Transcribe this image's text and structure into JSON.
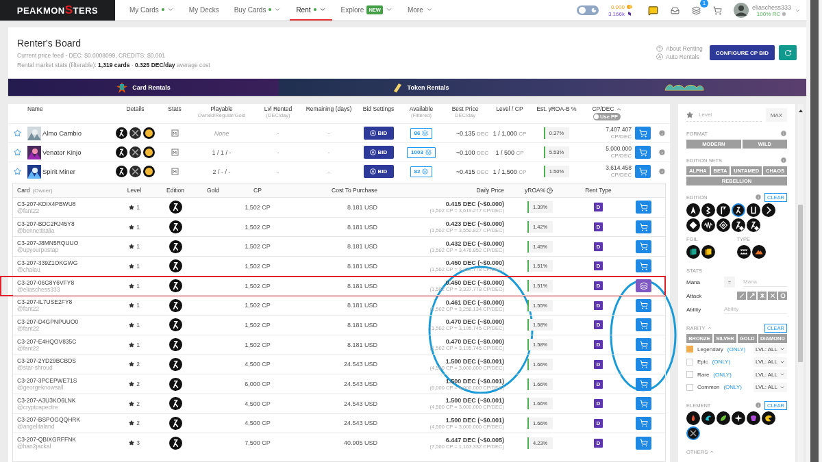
{
  "nav": {
    "logo": {
      "before": "PEAKMON",
      "accent": "S",
      "after": "TERS"
    },
    "items": [
      {
        "label": "My Cards",
        "dot": true,
        "caret": true,
        "selected": false
      },
      {
        "label": "My Decks",
        "dot": false,
        "caret": false,
        "selected": false
      },
      {
        "label": "Buy Cards",
        "dot": true,
        "caret": true,
        "selected": false
      },
      {
        "label": "Rent",
        "dot": true,
        "caret": true,
        "selected": true
      },
      {
        "label": "Explore",
        "dot": false,
        "badge": "NEW",
        "caret": true,
        "selected": false
      },
      {
        "label": "More",
        "dot": false,
        "caret": true,
        "selected": false
      }
    ],
    "dark_mode": {
      "on": false
    },
    "balances": [
      {
        "value": "0.000",
        "kind": "dec"
      },
      {
        "value": "3.166k",
        "kind": "sps"
      }
    ],
    "notifications": "1",
    "user": {
      "name": "eliaschess333",
      "rc": "100% RC"
    }
  },
  "header": {
    "title": "Renter's Board",
    "price_feed": "Current price feed - DEC: $0.0008099, CREDITS: $0.001",
    "stats": "Rental market stats (filterable): **1,319 cards**  ·  **0.325 DEC/day** average cost",
    "links": [
      {
        "label": "About Renting",
        "kind": "help"
      },
      {
        "label": "Auto Rentals",
        "kind": "auto"
      }
    ],
    "configure": "CONFIGURE CP BID"
  },
  "banner": [
    {
      "kind": "cards",
      "label": "Card Rentals"
    },
    {
      "kind": "tokens",
      "label": "Token Rentals"
    },
    {
      "kind": "logo"
    }
  ],
  "rentals": {
    "columns": [
      {
        "label": "Name"
      },
      {
        "label": "Details"
      },
      {
        "label": "Stats"
      },
      {
        "label": "Playable",
        "sub": "Owned/Regular/Gold"
      },
      {
        "label": "Lvl Rented",
        "sub": "(DEC/day)"
      },
      {
        "label": "Remaining (days)"
      },
      {
        "label": "Bid Settings"
      },
      {
        "label": "Available",
        "sub": "(Filtered)"
      },
      {
        "label": "Best Price",
        "sub": "DEC/day"
      },
      {
        "label": "Level / CP"
      },
      {
        "label": "Est. yROA-B %"
      },
      {
        "label": "CP/DEC",
        "sort_ascending": true
      }
    ],
    "use_pp": {
      "label": "Use PP",
      "on": false
    },
    "rows": [
      {
        "name": "Almo Cambio",
        "favorite": false,
        "playable": {
          "text": "None",
          "kind": "empty"
        },
        "lvl_rented": "-",
        "remaining": "-",
        "bid": "BID",
        "available": "86",
        "best_price": "~0.135",
        "best_unit": "DEC",
        "level": "1 / 1,000",
        "level_unit": "CP",
        "yroa": "0.37%",
        "cp_dec": "7,407.407",
        "cp_dec_unit": "CP/DEC"
      },
      {
        "name": "Venator Kinjo",
        "favorite": false,
        "playable": {
          "text": "1 / 1 / -",
          "kind": "count"
        },
        "lvl_rented": "-",
        "remaining": "-",
        "bid": "BID",
        "available": "1003",
        "best_price": "~0.100",
        "best_unit": "DEC",
        "level": "1 / 500",
        "level_unit": "CP",
        "yroa": "5.53%",
        "cp_dec": "5,000.000",
        "cp_dec_unit": "CP/DEC"
      },
      {
        "name": "Spirit Miner",
        "favorite": false,
        "playable": {
          "text": "2 / - / -",
          "kind": "count"
        },
        "lvl_rented": "-",
        "remaining": "-",
        "bid": "BID",
        "available": "82",
        "best_price": "~0.415",
        "best_unit": "DEC",
        "level": "1 / 1,500",
        "level_unit": "CP",
        "yroa": "1.50%",
        "cp_dec": "3,614.458",
        "cp_dec_unit": "CP/DEC"
      }
    ]
  },
  "listings": {
    "columns": [
      {
        "label": "Card",
        "sub": "(Owner)",
        "help": false
      },
      {
        "label": "Level",
        "help": false
      },
      {
        "label": "Edition",
        "help": false
      },
      {
        "label": "Gold",
        "help": false
      },
      {
        "label": "CP",
        "help": false
      },
      {
        "label": "Cost To Purchase",
        "help": false
      },
      {
        "label": "Daily Price",
        "help": false
      },
      {
        "label": "yROA%",
        "help": true
      },
      {
        "label": "Rent Type",
        "help": false
      }
    ],
    "rows": [
      {
        "id": "C3-207-KDIX4PBWU8",
        "owner": "@fant22",
        "level": "1",
        "cp": "1,502 CP",
        "cost": "8.181 USD",
        "price": "0.415 DEC (~$0.000)",
        "price_detail": "(1,502 CP = 3,619.277 CP/DEC)",
        "yroa": "1.39%",
        "rent_type": "D",
        "own": false,
        "highlighted": false
      },
      {
        "id": "C3-207-BDC2RJ45Y8",
        "owner": "@bennettitalia",
        "level": "1",
        "cp": "1,502 CP",
        "cost": "8.181 USD",
        "price": "0.423 DEC (~$0.000)",
        "price_detail": "(1,502 CP = 3,550.827 CP/DEC)",
        "yroa": "1.42%",
        "rent_type": "D",
        "own": false,
        "highlighted": false
      },
      {
        "id": "C3-207-J8MN5RQUUO",
        "owner": "@upyourpostap",
        "level": "1",
        "cp": "1,502 CP",
        "cost": "8.181 USD",
        "price": "0.432 DEC (~$0.000)",
        "price_detail": "(1,502 CP = 3,476.852 CP/DEC)",
        "yroa": "1.45%",
        "rent_type": "D",
        "own": false,
        "highlighted": false
      },
      {
        "id": "C3-207-339Z1OKGWG",
        "owner": "@chalau",
        "level": "1",
        "cp": "1,502 CP",
        "cost": "8.181 USD",
        "price": "0.450 DEC (~$0.000)",
        "price_detail": "(1,502 CP = 3,337.778 CP/DEC)",
        "yroa": "1.51%",
        "rent_type": "D",
        "own": false,
        "highlighted": false
      },
      {
        "id": "C3-207-06G8Y6VFY8",
        "owner": "@eliaschess333",
        "level": "1",
        "cp": "1,502 CP",
        "cost": "8.181 USD",
        "price": "0.450 DEC (~$0.000)",
        "price_detail": "(1,502 CP = 3,337.778 CP/DEC)",
        "yroa": "1.51%",
        "rent_type": "D",
        "own": true,
        "highlighted": true
      },
      {
        "id": "C3-207-IL7USE2FY8",
        "owner": "@fant22",
        "level": "1",
        "cp": "1,502 CP",
        "cost": "8.181 USD",
        "price": "0.461 DEC (~$0.000)",
        "price_detail": "(1,502 CP = 3,258.134 CP/DEC)",
        "yroa": "1.55%",
        "rent_type": "D",
        "own": false,
        "highlighted": false
      },
      {
        "id": "C3-207-D4GPNPUUO0",
        "owner": "@fant22",
        "level": "1",
        "cp": "1,502 CP",
        "cost": "8.181 USD",
        "price": "0.470 DEC (~$0.000)",
        "price_detail": "(1,502 CP = 3,195.745 CP/DEC)",
        "yroa": "1.58%",
        "rent_type": "D",
        "own": false,
        "highlighted": false
      },
      {
        "id": "C3-207-E4HQOV835C",
        "owner": "@fant22",
        "level": "1",
        "cp": "1,502 CP",
        "cost": "8.181 USD",
        "price": "0.470 DEC (~$0.000)",
        "price_detail": "(1,502 CP = 3,195.745 CP/DEC)",
        "yroa": "1.58%",
        "rent_type": "D",
        "own": false,
        "highlighted": false
      },
      {
        "id": "C3-207-2YD29BCBDS",
        "owner": "@star-shroud",
        "level": "2",
        "cp": "4,500 CP",
        "cost": "24.543 USD",
        "price": "1.500 DEC (~$0.001)",
        "price_detail": "(4,500 CP = 3,000.000 CP/DEC)",
        "yroa": "1.66%",
        "rent_type": "D",
        "own": false,
        "highlighted": false
      },
      {
        "id": "C3-207-3PCEPWE71S",
        "owner": "@georgeknowsall",
        "level": "2",
        "cp": "6,000 CP",
        "cost": "24.543 USD",
        "price": "1.500 DEC (~$0.001)",
        "price_detail": "(6,000 CP = 4,000.000 CP/DEC)",
        "yroa": "1.66%",
        "rent_type": "D",
        "own": false,
        "highlighted": false
      },
      {
        "id": "C3-207-A3U3KO6LNK",
        "owner": "@cryptospectre",
        "level": "2",
        "cp": "4,500 CP",
        "cost": "24.543 USD",
        "price": "1.500 DEC (~$0.001)",
        "price_detail": "(4,500 CP = 3,000.000 CP/DEC)",
        "yroa": "1.66%",
        "rent_type": "D",
        "own": false,
        "highlighted": false
      },
      {
        "id": "C3-207-BSPOGQQHRK",
        "owner": "@angelitaland",
        "level": "2",
        "cp": "4,500 CP",
        "cost": "24.543 USD",
        "price": "1.500 DEC (~$0.001)",
        "price_detail": "(4,500 CP = 3,000.000 CP/DEC)",
        "yroa": "1.66%",
        "rent_type": "D",
        "own": false,
        "highlighted": false
      },
      {
        "id": "C3-207-QBIXGRFFNK",
        "owner": "@han2jackal",
        "level": "3",
        "cp": "7,500 CP",
        "cost": "40.905 USD",
        "price": "6.447 DEC (~$0.005)",
        "price_detail": "(7,500 CP = 1,163.332 CP/DEC)",
        "yroa": "4.23%",
        "rent_type": "D",
        "own": false,
        "highlighted": false
      }
    ]
  },
  "filters": {
    "level": {
      "placeholder": "Level",
      "button": "MAX"
    },
    "format": {
      "title": "FORMAT",
      "options": [
        {
          "label": "MODERN",
          "selected": false
        },
        {
          "label": "WILD",
          "selected": false
        }
      ]
    },
    "edition_sets": {
      "title": "EDITION SETS",
      "options": [
        {
          "label": "ALPHA",
          "selected": false
        },
        {
          "label": "BETA",
          "selected": false
        },
        {
          "label": "UNTAMED",
          "selected": false
        },
        {
          "label": "CHAOS",
          "selected": false
        },
        {
          "label": "REBELLION",
          "selected": false
        }
      ]
    },
    "edition": {
      "title": "EDITION",
      "clear": "CLEAR",
      "icons": [
        {
          "kind": "arrow",
          "selected": false
        },
        {
          "kind": "zigzag",
          "selected": false
        },
        {
          "kind": "flag",
          "selected": false
        },
        {
          "kind": "runner",
          "selected": true
        },
        {
          "kind": "pillar",
          "selected": false
        },
        {
          "kind": "chevron",
          "selected": false
        },
        {
          "kind": "diamond",
          "selected": false
        },
        {
          "kind": "wave",
          "selected": false
        },
        {
          "kind": "gem",
          "selected": false
        },
        {
          "kind": "runner-badge",
          "selected": false
        },
        {
          "kind": "runner-gem",
          "selected": false
        }
      ]
    },
    "foil": {
      "title": "FOIL",
      "icons": [
        {
          "kind": "teal-cards",
          "selected": false
        },
        {
          "kind": "gold-cards",
          "selected": false
        }
      ]
    },
    "type": {
      "title": "TYPE",
      "icons": [
        {
          "kind": "fangs",
          "selected": false
        },
        {
          "kind": "mountain",
          "selected": false
        }
      ]
    },
    "stats": {
      "title": "STATS",
      "mana": {
        "label": "Mana",
        "operator": "=",
        "placeholder": "Mana"
      },
      "attack": {
        "label": "Attack",
        "icons": [
          {
            "kind": "sword",
            "selected": false
          },
          {
            "kind": "arrow",
            "selected": false
          },
          {
            "kind": "burst",
            "selected": false
          },
          {
            "kind": "cross",
            "selected": false
          },
          {
            "kind": "ring",
            "selected": false
          }
        ]
      },
      "ability": {
        "label": "Ability",
        "placeholder": "Ability"
      }
    },
    "rarity": {
      "title": "RARITY",
      "expanded": true,
      "clear": "CLEAR",
      "tiers": [
        {
          "label": "BRONZE",
          "selected": false
        },
        {
          "label": "SILVER",
          "selected": false
        },
        {
          "label": "GOLD",
          "selected": false
        },
        {
          "label": "DIAMOND",
          "selected": false
        }
      ],
      "items": [
        {
          "label": "Legendary",
          "only": "(ONLY)",
          "level": "LVL: ALL",
          "checked": true
        },
        {
          "label": "Epic",
          "only": "(ONLY)",
          "level": "LVL: ALL",
          "checked": false
        },
        {
          "label": "Rare",
          "only": "(ONLY)",
          "level": "LVL: ALL",
          "checked": false
        },
        {
          "label": "Common",
          "only": "(ONLY)",
          "level": "LVL: ALL",
          "checked": false
        }
      ]
    },
    "element": {
      "title": "ELEMENT",
      "clear": "CLEAR",
      "icons": [
        {
          "kind": "fire",
          "selected": false
        },
        {
          "kind": "water",
          "selected": false
        },
        {
          "kind": "earth",
          "selected": false
        },
        {
          "kind": "life",
          "selected": false
        },
        {
          "kind": "death",
          "selected": false
        },
        {
          "kind": "dragon",
          "selected": false
        },
        {
          "kind": "neutral",
          "selected": true
        }
      ]
    },
    "others": {
      "title": "OTHERS",
      "expanded": true
    }
  }
}
